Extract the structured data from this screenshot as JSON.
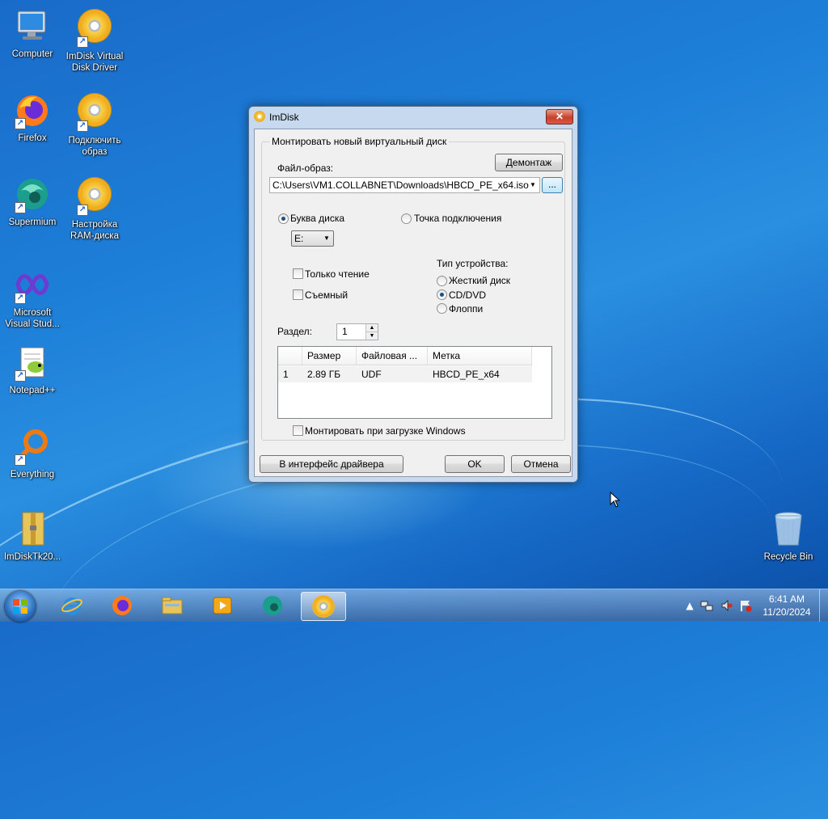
{
  "desktop": {
    "icons": [
      {
        "label": "Computer"
      },
      {
        "label": "ImDisk Virtual Disk Driver"
      },
      {
        "label": "Firefox"
      },
      {
        "label": "Подключить образ"
      },
      {
        "label": "Supermium"
      },
      {
        "label": "Настройка RAM-диска"
      },
      {
        "label": "Microsoft Visual Stud..."
      },
      {
        "label": "Notepad++"
      },
      {
        "label": "Everything"
      },
      {
        "label": "ImDiskTk20..."
      },
      {
        "label": "Recycle Bin"
      }
    ]
  },
  "dialog": {
    "title": "ImDisk",
    "close_label": "✕",
    "group_title": "Монтировать новый виртуальный диск",
    "image_label": "Файл-образ:",
    "unmount_label": "Демонтаж",
    "image_path": "C:\\Users\\VM1.COLLABNET\\Downloads\\HBCD_PE_x64.iso",
    "browse_label": "...",
    "drive_letter_label": "Буква диска",
    "mount_point_label": "Точка подключения",
    "drive_letter_value": "E:",
    "readonly_label": "Только чтение",
    "removable_label": "Съемный",
    "device_type_label": "Тип устройства:",
    "device_types": [
      "Жесткий диск",
      "CD/DVD",
      "Флоппи"
    ],
    "selected_device_type": "CD/DVD",
    "partition_label": "Раздел:",
    "partition_value": "1",
    "partitions_table": {
      "columns": [
        "",
        "Размер",
        "Файловая ...",
        "Метка"
      ],
      "rows": [
        {
          "index": "1",
          "size": "2.89 ГБ",
          "fs": "UDF",
          "label": "HBCD_PE_x64"
        }
      ]
    },
    "mount_at_startup_label": "Монтировать при загрузке Windows",
    "driver_ui_label": "В интерфейс драйвера",
    "ok_label": "OK",
    "cancel_label": "Отмена"
  },
  "taskbar": {
    "time": "6:41 AM",
    "date": "11/20/2024",
    "tray_arrow": "▲"
  }
}
